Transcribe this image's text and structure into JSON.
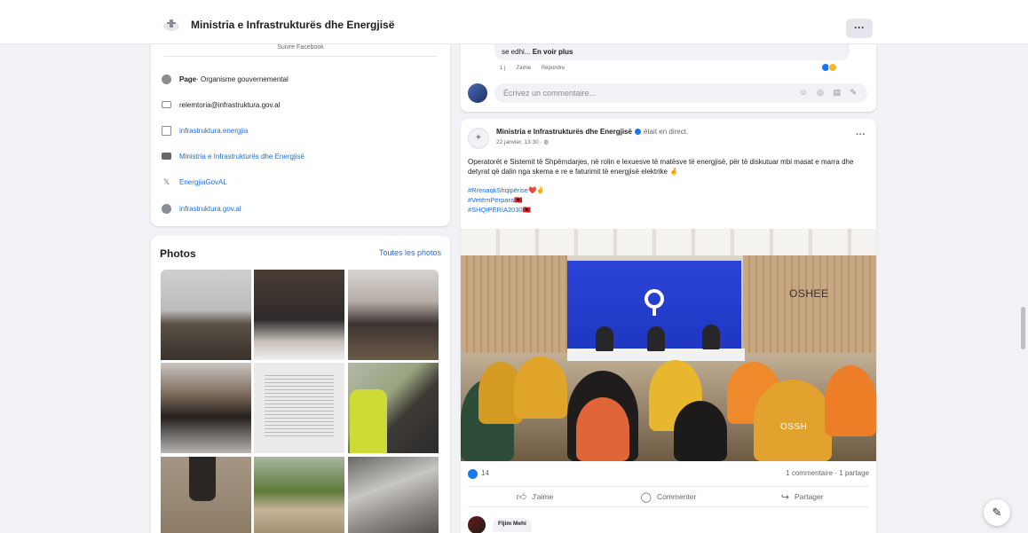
{
  "header": {
    "page_title": "Ministria e Infrastrukturës dhe Energjisë",
    "more_label": "···"
  },
  "intro": {
    "top_text": "Suivre Facebook",
    "category_label": "Page",
    "category_value": " · Organisme gouvernemental",
    "email": "relemtoria@infrastruktura.gov.al",
    "instagram": "infrastruktura.energjia",
    "youtube": "Ministria e Infrastrukturës dhe Energjisë",
    "twitter": "EnergjiaGovAL",
    "website": "infrastruktura.gov.al",
    "icons": [
      "info-icon",
      "email-icon",
      "instagram-icon",
      "youtube-icon",
      "x-icon",
      "globe-icon"
    ]
  },
  "photos": {
    "title": "Photos",
    "see_all": "Toutes les photos",
    "count": 9
  },
  "previous_post": {
    "comment_text": "se edhi... ",
    "see_more": "En voir plus",
    "comment_actions": [
      "1 j",
      "J'aime",
      "Répondre"
    ],
    "write_comment_placeholder": "Écrivez un commentaire...",
    "input_icons": "☺ ◎ ▤ ✎"
  },
  "post": {
    "author": "Ministria e Infrastrukturës dhe Energjisë",
    "status": "était en direct.",
    "date": "22 janvier, 13:30 · ◍",
    "more_label": "···",
    "text": "Operatorët e Sistemit të Shpërndarjes, në rolin e lexuesve të matësve të energjisë, për të diskutuar mbi masat e marra dhe detyrat që dalin nga skema e re e faturimit të energjisë elektrike 🤞",
    "hashtags": [
      "#RrenaqkShqipërise❤️✌",
      "#VetëmPërpara🇦🇱",
      "#SHQIPËRIA2030🇦🇱"
    ],
    "photo_wall_text": "OSHEE",
    "photo_vest_text": "OSSH",
    "like_count": "14",
    "stats_right": "1 commentaire · 1 partage",
    "actions": {
      "like": "J'aime",
      "comment": "Commenter",
      "share": "Partager"
    },
    "next_commenter": "Fljim Mehi"
  },
  "colors": {
    "brand_blue": "#1877f2",
    "link": "#216fdb",
    "background": "#f0f2f5"
  },
  "fab_icon": "edit-icon"
}
